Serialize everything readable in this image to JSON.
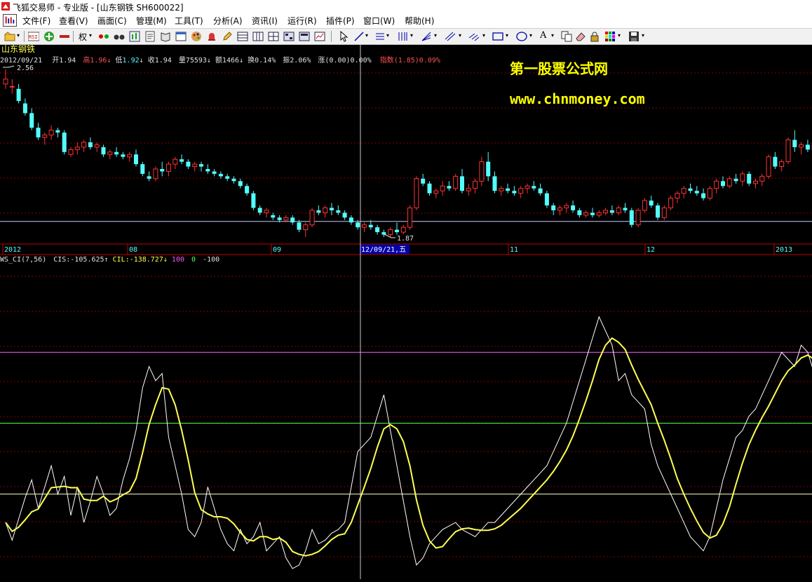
{
  "window": {
    "title": "飞狐交易师 - 专业版 - [山东钢铁 SH600022]"
  },
  "menu": {
    "items": [
      "文件(F)",
      "查看(V)",
      "画面(C)",
      "管理(M)",
      "工具(T)",
      "分析(A)",
      "资讯(I)",
      "运行(R)",
      "插件(P)",
      "窗口(W)",
      "帮助(H)"
    ]
  },
  "toolbar": {
    "rsi_label": "RSI",
    "quan_label": "权",
    "text_tool_label": "A"
  },
  "colors": {
    "background": "#000000",
    "up": "#ff3232",
    "down": "#54ffff",
    "guide": "#c8c8ff",
    "ci_line": "#ffffff",
    "cil_line": "#ffff54",
    "level_100": "#ff54ff",
    "level_0": "#54ff54",
    "level_m100": "#ffffc0",
    "watermark": "#ffff00",
    "highlight": "#0000aa"
  },
  "stock": {
    "name": "山东钢铁",
    "date": "2012/09/21",
    "open_label": "开",
    "open": "1.94",
    "high_label": "高",
    "high": "1.96",
    "low_label": "低",
    "low": "1.92",
    "close_label": "收",
    "close": "1.94",
    "volume_label": "量",
    "volume": "75593",
    "amount_label": "额",
    "amount": "1466",
    "turnover_label": "换",
    "turnover": "0.14%",
    "amplitude_label": "振",
    "amplitude": "2.06%",
    "change_label": "涨",
    "change": "(0.00)0.00%",
    "index_label": "指数",
    "index": "(1.85)0.09%",
    "max_price_label": "2.56",
    "min_price_label": "1.87"
  },
  "watermark": {
    "line1": "第一股票公式网",
    "line2": "www.chnmoney.com"
  },
  "date_axis": {
    "ticks": [
      "2012",
      "08",
      "09",
      "11",
      "12",
      "2013"
    ],
    "cursor_label": "12/09/21,五"
  },
  "indicator": {
    "name": "WS_CI(7,56)",
    "cis_label": "CIS:",
    "cis_value": "-105.625",
    "cil_label": "CIL:",
    "cil_value": "-138.727",
    "level_labels": [
      "100",
      "0",
      "-100"
    ]
  },
  "chart_data": [
    {
      "type": "candlestick",
      "title": "山东钢铁 SH600022",
      "ylim": [
        1.87,
        2.56
      ],
      "series": [
        {
          "name": "ohlc",
          "values": [
            [
              2.5,
              2.56,
              2.48,
              2.52
            ],
            [
              2.49,
              2.52,
              2.46,
              2.49
            ],
            [
              2.48,
              2.5,
              2.42,
              2.43
            ],
            [
              2.42,
              2.44,
              2.37,
              2.38
            ],
            [
              2.38,
              2.4,
              2.31,
              2.32
            ],
            [
              2.32,
              2.34,
              2.27,
              2.28
            ],
            [
              2.28,
              2.3,
              2.25,
              2.29
            ],
            [
              2.29,
              2.33,
              2.27,
              2.31
            ],
            [
              2.31,
              2.32,
              2.28,
              2.3
            ],
            [
              2.3,
              2.31,
              2.21,
              2.22
            ],
            [
              2.21,
              2.24,
              2.2,
              2.23
            ],
            [
              2.23,
              2.26,
              2.21,
              2.24
            ],
            [
              2.24,
              2.27,
              2.22,
              2.26
            ],
            [
              2.26,
              2.28,
              2.23,
              2.24
            ],
            [
              2.24,
              2.26,
              2.22,
              2.25
            ],
            [
              2.24,
              2.25,
              2.2,
              2.21
            ],
            [
              2.21,
              2.23,
              2.19,
              2.22
            ],
            [
              2.22,
              2.24,
              2.2,
              2.21
            ],
            [
              2.21,
              2.22,
              2.19,
              2.2
            ],
            [
              2.2,
              2.22,
              2.18,
              2.21
            ],
            [
              2.21,
              2.23,
              2.16,
              2.17
            ],
            [
              2.17,
              2.18,
              2.12,
              2.13
            ],
            [
              2.12,
              2.14,
              2.1,
              2.11
            ],
            [
              2.11,
              2.16,
              2.1,
              2.15
            ],
            [
              2.15,
              2.18,
              2.12,
              2.14
            ],
            [
              2.14,
              2.18,
              2.12,
              2.17
            ],
            [
              2.17,
              2.2,
              2.15,
              2.19
            ],
            [
              2.19,
              2.21,
              2.17,
              2.18
            ],
            [
              2.18,
              2.19,
              2.15,
              2.16
            ],
            [
              2.16,
              2.18,
              2.14,
              2.17
            ],
            [
              2.17,
              2.18,
              2.14,
              2.16
            ],
            [
              2.15,
              2.17,
              2.13,
              2.14
            ],
            [
              2.14,
              2.15,
              2.12,
              2.13
            ],
            [
              2.13,
              2.14,
              2.11,
              2.12
            ],
            [
              2.12,
              2.13,
              2.1,
              2.11
            ],
            [
              2.11,
              2.12,
              2.09,
              2.1
            ],
            [
              2.1,
              2.11,
              2.07,
              2.08
            ],
            [
              2.08,
              2.09,
              2.04,
              2.05
            ],
            [
              2.05,
              2.06,
              1.98,
              1.99
            ],
            [
              1.99,
              2.0,
              1.96,
              1.97
            ],
            [
              1.97,
              1.99,
              1.95,
              1.98
            ],
            [
              1.96,
              1.97,
              1.94,
              1.95
            ],
            [
              1.95,
              1.96,
              1.93,
              1.94
            ],
            [
              1.94,
              1.96,
              1.93,
              1.95
            ],
            [
              1.95,
              1.96,
              1.92,
              1.93
            ],
            [
              1.93,
              1.94,
              1.89,
              1.9
            ],
            [
              1.9,
              1.93,
              1.87,
              1.92
            ],
            [
              1.92,
              1.99,
              1.91,
              1.98
            ],
            [
              1.98,
              2.0,
              1.96,
              1.97
            ],
            [
              1.97,
              2.0,
              1.95,
              1.99
            ],
            [
              1.99,
              2.01,
              1.96,
              1.98
            ],
            [
              1.98,
              2.0,
              1.96,
              1.97
            ],
            [
              1.97,
              1.98,
              1.94,
              1.95
            ],
            [
              1.95,
              1.96,
              1.92,
              1.93
            ],
            [
              1.93,
              1.94,
              1.9,
              1.91
            ],
            [
              1.91,
              1.93,
              1.89,
              1.92
            ],
            [
              1.92,
              1.94,
              1.9,
              1.91
            ],
            [
              1.91,
              1.92,
              1.88,
              1.89
            ],
            [
              1.89,
              1.9,
              1.87,
              1.88
            ],
            [
              1.88,
              1.91,
              1.87,
              1.9
            ],
            [
              1.9,
              1.93,
              1.88,
              1.89
            ],
            [
              1.89,
              1.92,
              1.88,
              1.91
            ],
            [
              1.91,
              2.0,
              1.9,
              1.99
            ],
            [
              1.99,
              2.12,
              1.98,
              2.11
            ],
            [
              2.11,
              2.13,
              2.08,
              2.09
            ],
            [
              2.09,
              2.1,
              2.04,
              2.05
            ],
            [
              2.05,
              2.07,
              2.03,
              2.06
            ],
            [
              2.06,
              2.1,
              2.04,
              2.08
            ],
            [
              2.08,
              2.1,
              2.06,
              2.07
            ],
            [
              2.07,
              2.13,
              2.06,
              2.12
            ],
            [
              2.12,
              2.15,
              2.05,
              2.06
            ],
            [
              2.06,
              2.09,
              2.04,
              2.07
            ],
            [
              2.07,
              2.11,
              2.05,
              2.1
            ],
            [
              2.1,
              2.2,
              2.08,
              2.18
            ],
            [
              2.18,
              2.22,
              2.1,
              2.12
            ],
            [
              2.12,
              2.14,
              2.05,
              2.06
            ],
            [
              2.06,
              2.08,
              2.04,
              2.07
            ],
            [
              2.07,
              2.09,
              2.05,
              2.06
            ],
            [
              2.06,
              2.08,
              2.04,
              2.05
            ],
            [
              2.05,
              2.08,
              2.03,
              2.07
            ],
            [
              2.07,
              2.09,
              2.05,
              2.08
            ],
            [
              2.08,
              2.1,
              2.06,
              2.07
            ],
            [
              2.07,
              2.09,
              2.04,
              2.05
            ],
            [
              2.05,
              2.06,
              1.99,
              2.0
            ],
            [
              2.0,
              2.01,
              1.96,
              1.98
            ],
            [
              1.98,
              2.0,
              1.96,
              1.99
            ],
            [
              1.99,
              2.01,
              1.97,
              2.0
            ],
            [
              2.0,
              2.02,
              1.97,
              1.98
            ],
            [
              1.98,
              1.99,
              1.95,
              1.96
            ],
            [
              1.96,
              1.98,
              1.95,
              1.97
            ],
            [
              1.97,
              1.99,
              1.95,
              1.96
            ],
            [
              1.96,
              1.98,
              1.95,
              1.97
            ],
            [
              1.97,
              1.99,
              1.96,
              1.98
            ],
            [
              1.98,
              2.0,
              1.96,
              1.97
            ],
            [
              1.97,
              2.0,
              1.96,
              1.99
            ],
            [
              1.99,
              2.01,
              1.97,
              1.98
            ],
            [
              1.98,
              1.99,
              1.91,
              1.92
            ],
            [
              1.92,
              1.99,
              1.91,
              1.98
            ],
            [
              1.98,
              2.03,
              1.97,
              2.02
            ],
            [
              2.02,
              2.04,
              1.99,
              2.0
            ],
            [
              2.0,
              2.01,
              1.94,
              1.95
            ],
            [
              1.95,
              2.0,
              1.94,
              1.99
            ],
            [
              1.99,
              2.04,
              1.98,
              2.03
            ],
            [
              2.03,
              2.06,
              2.01,
              2.05
            ],
            [
              2.05,
              2.08,
              2.03,
              2.07
            ],
            [
              2.07,
              2.09,
              2.05,
              2.06
            ],
            [
              2.06,
              2.08,
              2.04,
              2.05
            ],
            [
              2.05,
              2.07,
              2.02,
              2.03
            ],
            [
              2.03,
              2.08,
              2.02,
              2.07
            ],
            [
              2.07,
              2.11,
              2.05,
              2.1
            ],
            [
              2.1,
              2.12,
              2.07,
              2.08
            ],
            [
              2.08,
              2.12,
              2.07,
              2.11
            ],
            [
              2.11,
              2.13,
              2.09,
              2.1
            ],
            [
              2.1,
              2.14,
              2.08,
              2.13
            ],
            [
              2.13,
              2.14,
              2.08,
              2.09
            ],
            [
              2.09,
              2.11,
              2.07,
              2.1
            ],
            [
              2.1,
              2.13,
              2.08,
              2.12
            ],
            [
              2.12,
              2.21,
              2.11,
              2.2
            ],
            [
              2.2,
              2.22,
              2.15,
              2.16
            ],
            [
              2.16,
              2.19,
              2.14,
              2.18
            ],
            [
              2.18,
              2.28,
              2.17,
              2.27
            ],
            [
              2.27,
              2.31,
              2.22,
              2.24
            ],
            [
              2.24,
              2.26,
              2.21,
              2.25
            ],
            [
              2.25,
              2.27,
              2.22,
              2.23
            ],
            [
              2.23,
              2.26,
              2.22,
              2.25
            ],
            [
              2.25,
              2.27,
              2.2,
              2.21
            ]
          ]
        }
      ]
    },
    {
      "type": "line",
      "title": "WS_CI(7,56)",
      "ylim": [
        -220,
        220
      ],
      "series": [
        {
          "name": "CIS",
          "values": [
            -140,
            -165,
            -135,
            -105,
            -80,
            -120,
            -90,
            -60,
            -100,
            -75,
            -130,
            -90,
            -140,
            -110,
            -75,
            -100,
            -130,
            -120,
            -80,
            -50,
            -10,
            50,
            80,
            60,
            70,
            -20,
            -60,
            -100,
            -150,
            -160,
            -140,
            -90,
            -120,
            -150,
            -170,
            -180,
            -150,
            -170,
            -160,
            -140,
            -180,
            -170,
            -160,
            -190,
            -205,
            -200,
            -180,
            -150,
            -170,
            -165,
            -155,
            -150,
            -140,
            -90,
            -40,
            -30,
            -20,
            10,
            40,
            -10,
            -60,
            -110,
            -160,
            -200,
            -190,
            -170,
            -160,
            -150,
            -145,
            -140,
            -150,
            -155,
            -160,
            -150,
            -140,
            -140,
            -130,
            -120,
            -110,
            -100,
            -90,
            -80,
            -70,
            -60,
            -40,
            -20,
            0,
            30,
            60,
            90,
            120,
            150,
            130,
            110,
            60,
            70,
            40,
            30,
            20,
            -30,
            -60,
            -80,
            -100,
            -120,
            -140,
            -160,
            -170,
            -180,
            -160,
            -120,
            -80,
            -50,
            -20,
            -10,
            10,
            20,
            40,
            60,
            80,
            100,
            90,
            80,
            110,
            100,
            70,
            50,
            20,
            10,
            -20,
            -40,
            -60,
            -90,
            -110,
            -120,
            -100,
            -60
          ]
        }
      ]
    }
  ]
}
